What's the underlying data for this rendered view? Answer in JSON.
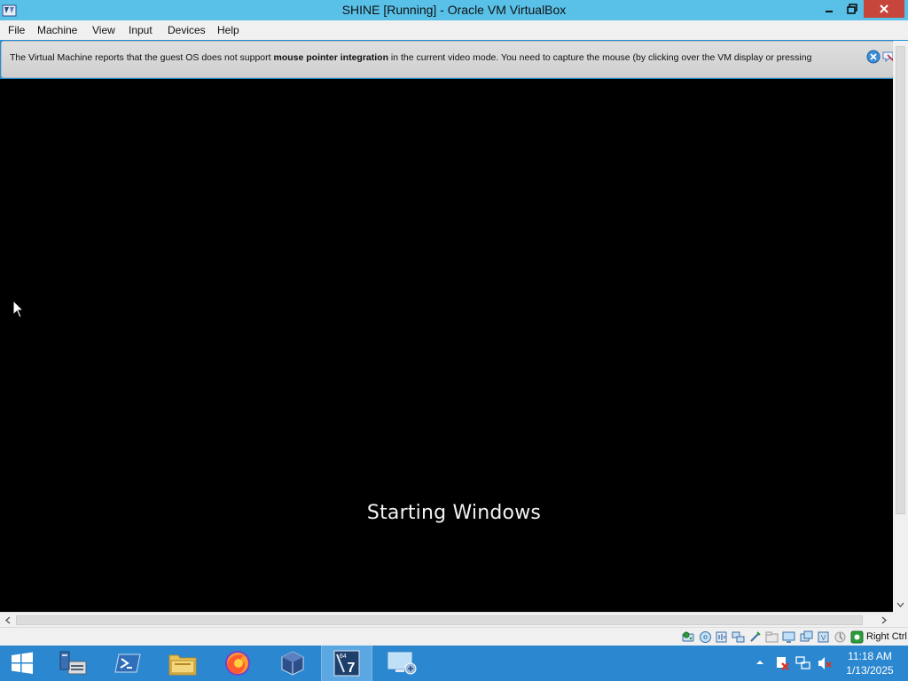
{
  "window": {
    "title": "SHINE [Running] - Oracle VM VirtualBox",
    "minimize_label": "",
    "maximize_label": "",
    "close_label": "",
    "close_color": "#c7463b",
    "titlebar_color": "#59c1e8"
  },
  "menu": {
    "items": [
      {
        "label": "File"
      },
      {
        "label": "Machine"
      },
      {
        "label": "View"
      },
      {
        "label": "Input"
      },
      {
        "label": "Devices"
      },
      {
        "label": "Help"
      }
    ]
  },
  "notice": {
    "text_before": "The Virtual Machine reports that the guest OS does not support ",
    "text_bold": "mouse pointer integration",
    "text_after": " in the current video mode. You need to capture the mouse (by clicking over the VM display or pressing",
    "close_icon": "close-icon",
    "forget_icon": "do-not-show-again-icon"
  },
  "vm": {
    "boot_text": "Starting Windows",
    "background": "#000000"
  },
  "statusbar": {
    "icons": [
      "hard-disk-icon",
      "optical-drive-icon",
      "audio-icon",
      "network-icon",
      "usb-icon",
      "shared-folders-icon",
      "display-icon",
      "video-capture-icon",
      "cpu-icon",
      "virtualization-icon",
      "mouse-integration-icon",
      "keyboard-capture-icon"
    ],
    "host_key": "Right Ctrl"
  },
  "taskbar": {
    "accent": "#2b87cf",
    "apps": [
      {
        "name": "server-manager-icon"
      },
      {
        "name": "powershell-icon"
      },
      {
        "name": "file-explorer-icon"
      },
      {
        "name": "firefox-icon"
      },
      {
        "name": "virtualbox-icon"
      },
      {
        "name": "windows-7-vm-icon",
        "active": true
      },
      {
        "name": "remote-desktop-icon"
      }
    ],
    "tray": {
      "icons": [
        "action-center-icon",
        "network-icon",
        "volume-muted-icon"
      ],
      "time": "11:18 AM",
      "date": "1/13/2025"
    }
  }
}
